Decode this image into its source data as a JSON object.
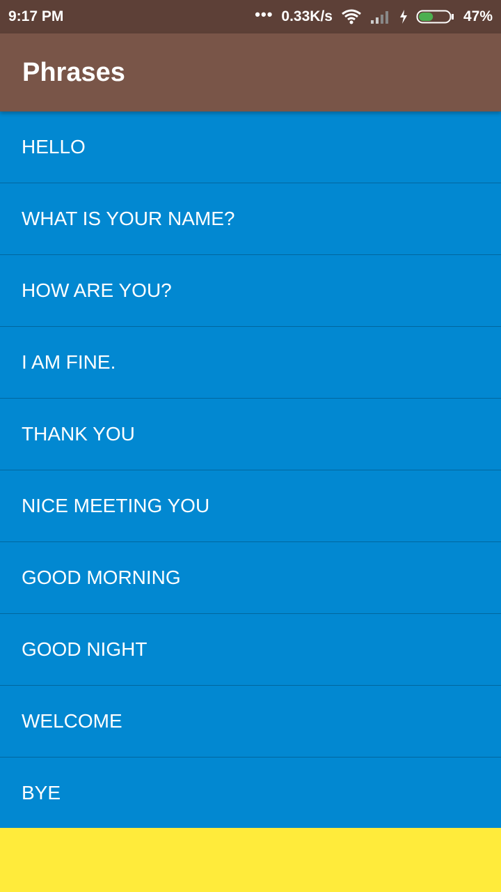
{
  "status_bar": {
    "time": "9:17 PM",
    "network_speed": "0.33K/s",
    "battery": "47%",
    "icons": [
      "more-dots-icon",
      "wifi-icon",
      "signal-icon",
      "charging-icon",
      "battery-icon"
    ],
    "battery_level": 0.47
  },
  "app_bar": {
    "title": "Phrases"
  },
  "phrases": [
    "HELLO",
    "WHAT IS YOUR NAME?",
    "HOW ARE YOU?",
    "I AM FINE.",
    "THANK YOU",
    "NICE MEETING YOU",
    "GOOD MORNING",
    "GOOD NIGHT",
    "WELCOME",
    "BYE"
  ],
  "colors": {
    "status_bar": "#5d4037",
    "app_bar": "#795548",
    "list_background": "#0288d1",
    "footer": "#ffeb3b",
    "battery_fill": "#4caf50"
  }
}
